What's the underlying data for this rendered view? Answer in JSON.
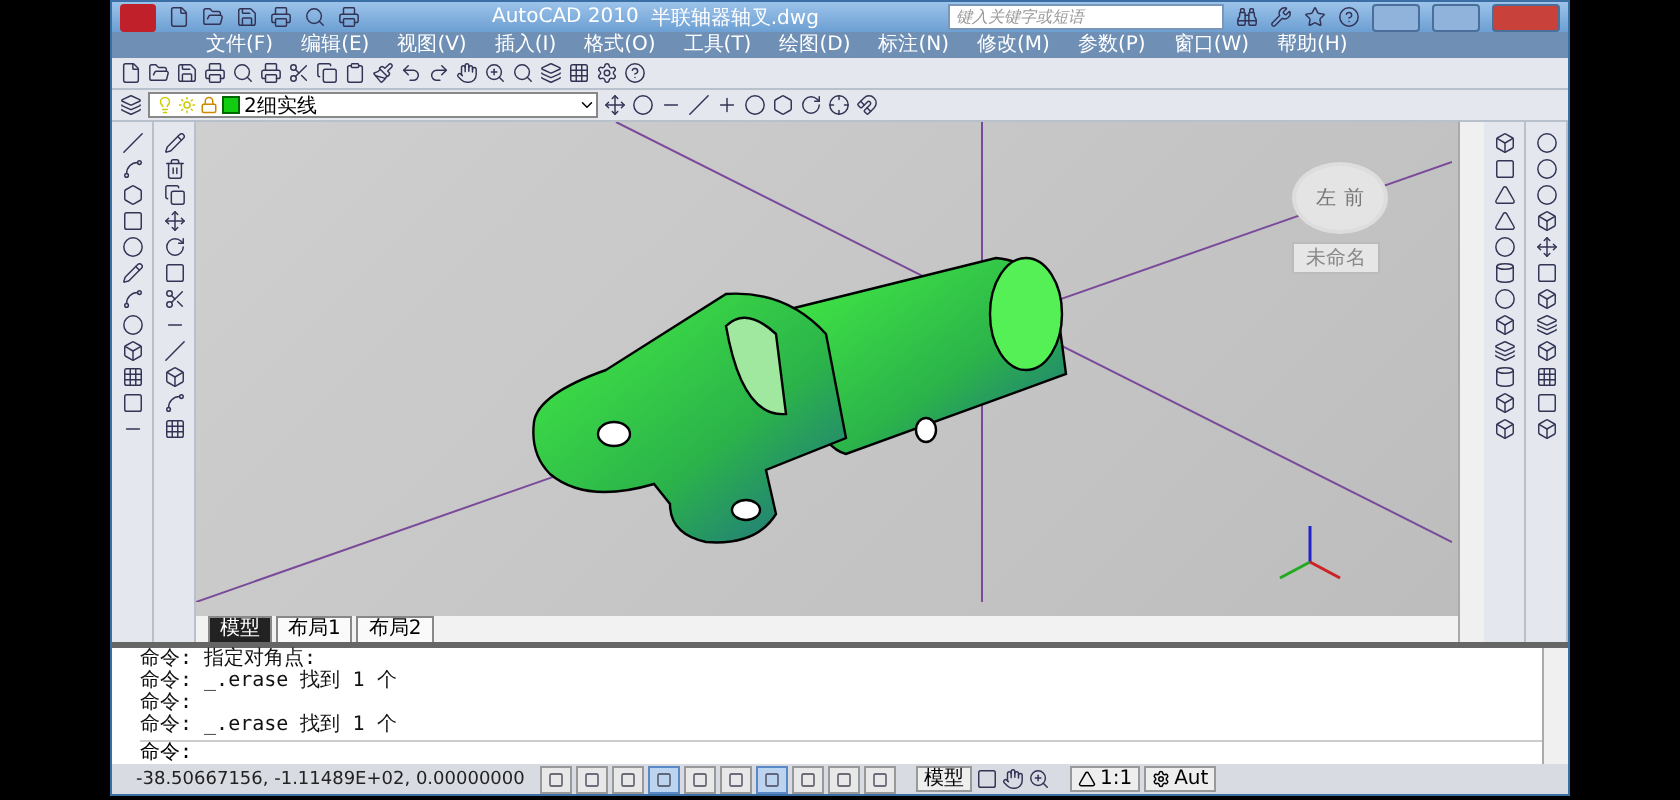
{
  "window": {
    "app_title": "AutoCAD 2010",
    "file_title": "半联轴器轴叉.dwg"
  },
  "search": {
    "placeholder": "键入关键字或短语"
  },
  "menu": [
    "文件(F)",
    "编辑(E)",
    "视图(V)",
    "插入(I)",
    "格式(O)",
    "工具(T)",
    "绘图(D)",
    "标注(N)",
    "修改(M)",
    "参数(P)",
    "窗口(W)",
    "帮助(H)"
  ],
  "layer": {
    "name": "2细实线"
  },
  "viewcube": {
    "faces": [
      "左",
      "前"
    ],
    "label": "未命名"
  },
  "layout_tabs": [
    {
      "label": "模型",
      "selected": true
    },
    {
      "label": "布局1",
      "selected": false
    },
    {
      "label": "布局2",
      "selected": false
    }
  ],
  "command_history": [
    "命令: 指定对角点:",
    "命令: _.erase 找到 1 个",
    "命令:",
    "命令: _.erase 找到 1 个"
  ],
  "command_prompt": "命令:",
  "status_bar": {
    "coordinates": "-38.50667156, -1.11489E+02, 0.00000000",
    "toggles": [
      {
        "on": false
      },
      {
        "on": false
      },
      {
        "on": false
      },
      {
        "on": true
      },
      {
        "on": false
      },
      {
        "on": false
      },
      {
        "on": true
      },
      {
        "on": false
      },
      {
        "on": false
      },
      {
        "on": false
      }
    ],
    "model_label": "模型",
    "scale": "1:1",
    "workspace": "Aut"
  }
}
